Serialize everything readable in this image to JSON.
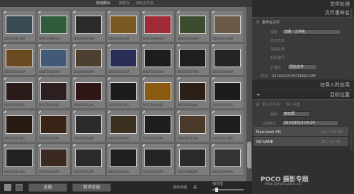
{
  "grid": {
    "tabs": [
      "所有照片",
      "新照片",
      "目标文件夹"
    ],
    "rows": [
      [
        {
          "name": "DSCF5005.RAF",
          "tone": "#3a4a55"
        },
        {
          "name": "DSCF5006.RAF",
          "tone": "#2f5d3c"
        },
        {
          "name": "DSCF5007.RAF",
          "tone": "#2a2a2a"
        },
        {
          "name": "DSCF5008.RAF",
          "tone": "#7a5a20"
        },
        {
          "name": "DSCF5009.RAF",
          "tone": "#a02a35"
        },
        {
          "name": "DSCF5010.RAF",
          "tone": "#3d4b2f"
        },
        {
          "name": "DSCF5011.RAF",
          "tone": "#6a5a48"
        }
      ],
      [
        {
          "name": "DSCF5012.RAF",
          "tone": "#6a4a20"
        },
        {
          "name": "DSCF5013.RAF",
          "tone": "#425a78"
        },
        {
          "name": "DSCF5014.RAF",
          "tone": "#4e4030"
        },
        {
          "name": "DSCF5015.RAF",
          "tone": "#2a2d55"
        },
        {
          "name": "DSCF5016.RAF",
          "tone": "#1d1d1d"
        },
        {
          "name": "DSCF5017.RAF",
          "tone": "#1f1f1f"
        },
        {
          "name": "DSCF5018.RAF",
          "tone": "#242424"
        }
      ],
      [
        {
          "name": "DSCF5019.JPG",
          "tone": "#2a1a1a"
        },
        {
          "name": "DSCF5020.JPG",
          "tone": "#2c1f1f"
        },
        {
          "name": "DSCF5021.JPG",
          "tone": "#301515"
        },
        {
          "name": "DSCF5022.JPG",
          "tone": "#1b1b1b"
        },
        {
          "name": "DSCF5023.JPG",
          "tone": "#8a5a10"
        },
        {
          "name": "DSCF5024.JPG",
          "tone": "#2b1f16"
        },
        {
          "name": "DSCF5025.JPG",
          "tone": "#1c1c1c"
        }
      ],
      [
        {
          "name": "DSCF5026.JPG",
          "tone": "#261a12"
        },
        {
          "name": "DSCF5027.JPG",
          "tone": "#3a2418"
        },
        {
          "name": "DSCF5028.JPG",
          "tone": "#2b2b2b"
        },
        {
          "name": "DSCF5029.JPG",
          "tone": "#3a3020"
        },
        {
          "name": "DSCF5030.JPG",
          "tone": "#1e1e1e"
        },
        {
          "name": "DSCF5031.JPG",
          "tone": "#4b3a2a"
        },
        {
          "name": "DSCF5032.JPG",
          "tone": "#1d1d1d"
        }
      ],
      [
        {
          "name": "DSCF5033.JPG",
          "tone": "#222"
        },
        {
          "name": "DSCF5034.JPG",
          "tone": "#3a2a20"
        },
        {
          "name": "DSCF5035.JPG",
          "tone": "#2a2a2a"
        },
        {
          "name": "DSCF5036.JPG",
          "tone": "#1f1f1f"
        },
        {
          "name": "DSCF5037.JPG",
          "tone": "#242424"
        },
        {
          "name": "DSCF5038.JPG",
          "tone": "#2a2a2a"
        },
        {
          "name": "DSCF5039.JPG",
          "tone": "#333"
        }
      ]
    ]
  },
  "bottom": {
    "select_all": "全选",
    "deselect_all": "取消全选",
    "sort_label": "排序依据:",
    "sort_value": "关",
    "thumbnail": "缩览图"
  },
  "right": {
    "title_file_processing": "文件处理",
    "title_rename": "文件重命名",
    "rename_checkbox": "重命名文件",
    "template_label": "模板",
    "template_value": "日期 - 文件名",
    "custom_text": "自定文本",
    "shoot_name": "拍摄名称",
    "start_number": "起始编号",
    "extension_label": "扩展名",
    "extension_value": "原始文件",
    "sample_label": "样本:",
    "sample_value": "20140424-PICS4965.RAF",
    "title_apply": "在导入时应用",
    "title_destination": "目标位置",
    "into_subfolder": "至子文件夹",
    "subfolder_value": "导入子集",
    "organize_label": "组织",
    "organize_value": "按日期",
    "date_format_label": "日期格式",
    "date_format_value": "2014/2014-04-24",
    "volume1_name": "Macintosh HD",
    "volume1_size": "42 / 120 GB",
    "volume2_name": "NO NAME",
    "volume2_size": "13 / 15 GB",
    "watermark": "POCO 摄影专题",
    "watermark_url": "http://photo.poco.cn/"
  },
  "colors": {
    "panel_bg": "#303030",
    "grid_bg": "#6e6e6e",
    "accent": "#e0e0e0"
  }
}
